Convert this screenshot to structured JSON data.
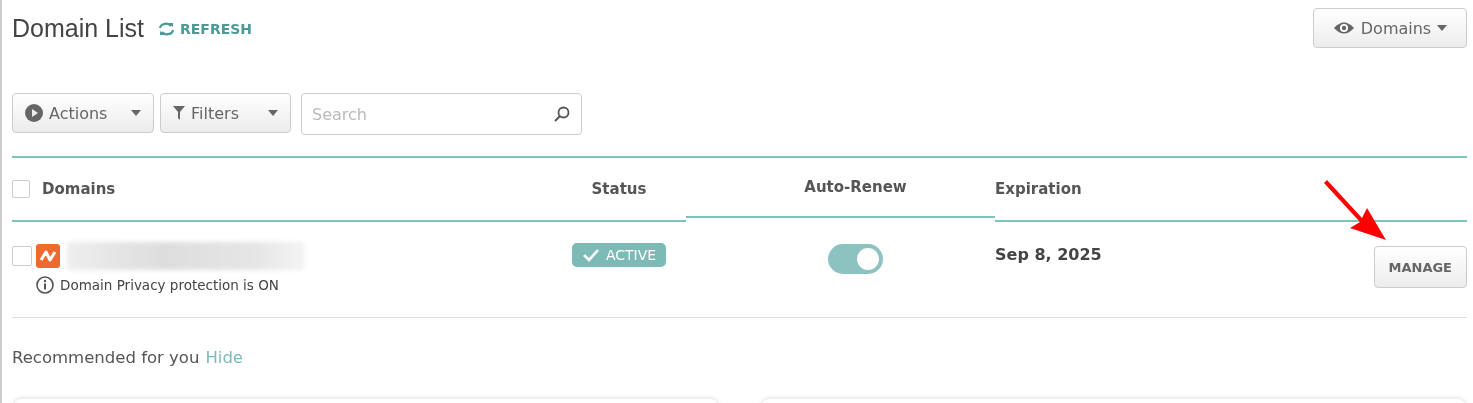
{
  "header": {
    "title": "Domain List",
    "refresh": "REFRESH",
    "view_button": "Domains"
  },
  "toolbar": {
    "actions": "Actions",
    "filters": "Filters",
    "search": {
      "placeholder": "Search"
    }
  },
  "table": {
    "select_all_checked": false,
    "columns": [
      "Domains",
      "Status",
      "Auto-Renew",
      "Expiration"
    ],
    "rows": [
      {
        "checked": false,
        "note": "Domain Privacy protection is ON",
        "status": "ACTIVE",
        "auto_renew": true,
        "expiration": "Sep 8, 2025",
        "action": "MANAGE"
      }
    ]
  },
  "recommended": {
    "title": "Recommended for you",
    "hide": "Hide"
  }
}
